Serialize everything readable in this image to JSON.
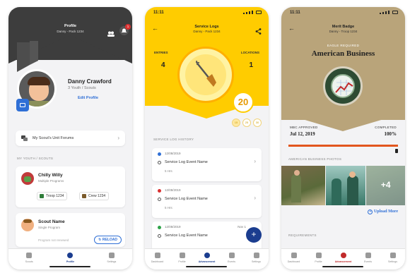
{
  "colors": {
    "brand_blue": "#1b3d8f",
    "service_yellow": "#ffcc00",
    "merit_tan": "#b9a47a",
    "accent_orange": "#e2561e"
  },
  "phone1": {
    "title": "Profile",
    "subtitle": "Danny - Pack 1234",
    "notification_count": "1",
    "name": "Danny Crawford",
    "meta": "3 Youth / Scouts",
    "edit_link": "Edit Profile",
    "forums": "My Scout's Unit Forums",
    "section_label": "MY YOUTH / SCOUTS",
    "youth": [
      {
        "name": "Chilly Willy",
        "sub": "Multiple Programs",
        "badges": [
          "Troop 1234",
          "Crew 1234"
        ]
      },
      {
        "name": "Scout Name",
        "sub": "Single Program",
        "note": "Program not renewed",
        "action": "RELOAD"
      }
    ],
    "tabs": [
      "Scouts",
      "Profile",
      "Settings"
    ],
    "active_tab": "Profile"
  },
  "phone2": {
    "time": "11:11",
    "title": "Service Logs",
    "subtitle": "Danny - Pack 1234",
    "entries_label": "ENTRIES",
    "entries_value": "4",
    "locations_label": "LOCATIONS",
    "locations_value": "1",
    "hours": "20",
    "dots": [
      "15",
      "25",
      "30"
    ],
    "section_label": "SERVICE LOG HISTORY",
    "logs": [
      {
        "date": "12/08/2019",
        "name": "Service Log Event Name",
        "hours": "5 Hrs",
        "color": "#2f6fd6"
      },
      {
        "date": "12/08/2019",
        "name": "Service Log Event Name",
        "hours": "5 Hrs",
        "color": "#d93030"
      },
      {
        "date": "12/08/2019",
        "name": "Service Log Event Name",
        "hours": "",
        "color": "#2fa34a",
        "extra": "Nov 1"
      }
    ],
    "fab": "+",
    "tabs": [
      "Dashboard",
      "Profile",
      "Advancement",
      "Events",
      "Settings"
    ],
    "active_tab": "Advancement"
  },
  "phone3": {
    "time": "11:11",
    "title": "Merit Badge",
    "subtitle": "Danny - Troop 1234",
    "required": "EAGLE REQUIRED",
    "badge_name": "American Business",
    "approved_label": "MBC APPROVED",
    "approved_value": "Jul 12, 2019",
    "completed_label": "COMPLETED",
    "completed_value": "100%",
    "completed_fraction": 1.0,
    "photos_label": "AMERICAN BUSINESS PHOTOS",
    "more_photos": "+4",
    "upload": "Upload More",
    "requirements_label": "REQUIREMENTS",
    "tabs": [
      "Dashboard",
      "Profile",
      "Advancement",
      "Events",
      "Settings"
    ],
    "active_tab": "Advancement"
  }
}
